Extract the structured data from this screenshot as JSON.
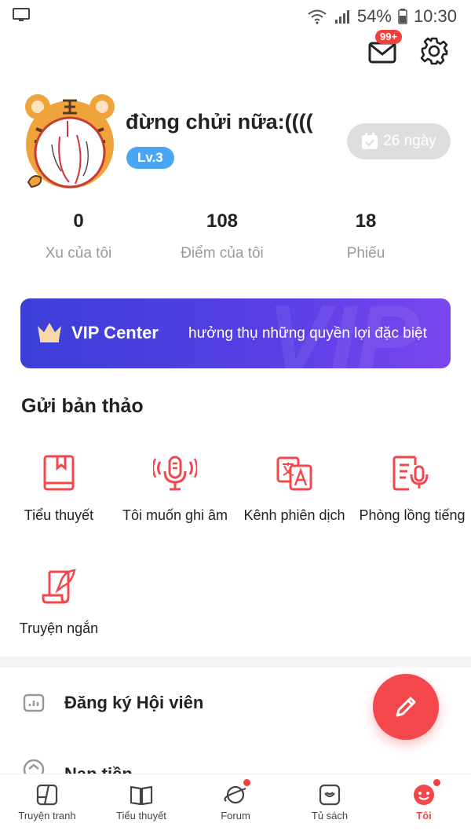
{
  "status_bar": {
    "battery": "54%",
    "time": "10:30"
  },
  "header": {
    "mail_badge": "99+",
    "mail_icon": "mail-icon",
    "settings_icon": "gear-icon"
  },
  "profile": {
    "username": "đừng chửi nữa:((((",
    "level": "Lv.3",
    "checkin_days": "26 ngày"
  },
  "stats": [
    {
      "value": "0",
      "label": "Xu của tôi"
    },
    {
      "value": "108",
      "label": "Điểm của tôi"
    },
    {
      "value": "18",
      "label": "Phiếu"
    }
  ],
  "vip": {
    "title": "VIP Center",
    "subtitle": "hưởng thụ những quyền lợi đặc biệt",
    "watermark": "VIP"
  },
  "submit_section": {
    "title": "Gửi bản thảo",
    "items": [
      {
        "label": "Tiểu thuyết",
        "icon": "book-icon"
      },
      {
        "label": "Tôi muốn ghi âm",
        "icon": "microphone-icon"
      },
      {
        "label": "Kênh phiên dịch",
        "icon": "translate-icon"
      },
      {
        "label": "Phòng lồng tiếng",
        "icon": "dubbing-icon"
      },
      {
        "label": "Truyện ngắn",
        "icon": "scroll-quill-icon"
      }
    ]
  },
  "menu": [
    {
      "label": "Đăng ký Hội viên",
      "icon": "chart-icon"
    },
    {
      "label": "Nạp tiền",
      "icon": "recharge-icon"
    }
  ],
  "tabbar": [
    {
      "label": "Truyện tranh",
      "icon": "comic-icon"
    },
    {
      "label": "Tiểu thuyết",
      "icon": "open-book-icon"
    },
    {
      "label": "Forum",
      "icon": "planet-icon"
    },
    {
      "label": "Tủ sách",
      "icon": "bookshelf-icon"
    },
    {
      "label": "Tôi",
      "icon": "smiley-icon"
    }
  ],
  "colors": {
    "accent": "#f3474c",
    "vip_start": "#3a3fd8",
    "vip_end": "#7b46f0",
    "level_badge": "#4aa6f3"
  }
}
